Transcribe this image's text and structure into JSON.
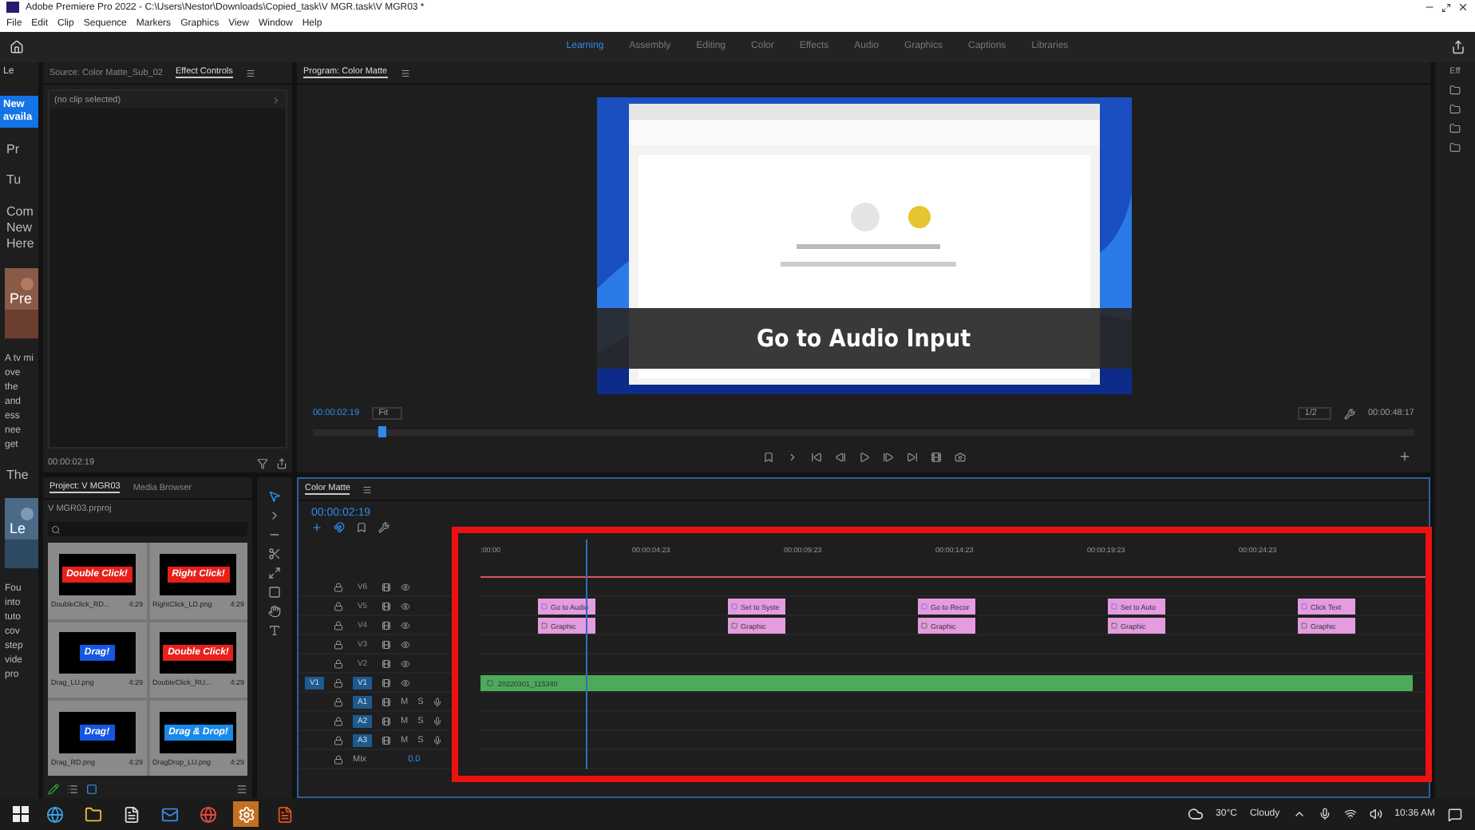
{
  "window": {
    "title": "Adobe Premiere Pro 2022 - C:\\Users\\Nestor\\Downloads\\Copied_task\\V MGR.task\\V MGR03 *"
  },
  "menu": [
    "File",
    "Edit",
    "Clip",
    "Sequence",
    "Markers",
    "Graphics",
    "View",
    "Window",
    "Help"
  ],
  "workspaces": [
    {
      "label": "Learning",
      "selected": true
    },
    {
      "label": "Assembly",
      "selected": false
    },
    {
      "label": "Editing",
      "selected": false
    },
    {
      "label": "Color",
      "selected": false
    },
    {
      "label": "Effects",
      "selected": false
    },
    {
      "label": "Audio",
      "selected": false
    },
    {
      "label": "Graphics",
      "selected": false
    },
    {
      "label": "Captions",
      "selected": false
    },
    {
      "label": "Libraries",
      "selected": false
    }
  ],
  "learn_panel": {
    "tab": "Le",
    "items": [
      {
        "kind": "banner",
        "text": "New availa"
      },
      {
        "kind": "heading",
        "text": "Pr"
      },
      {
        "kind": "heading",
        "text": "Tu"
      },
      {
        "kind": "heading",
        "text": "Com New Here"
      },
      {
        "kind": "picture",
        "text": "Pre"
      },
      {
        "kind": "body",
        "text": "A tv mi ove the and ess nee get"
      },
      {
        "kind": "heading",
        "text": "The"
      },
      {
        "kind": "picture",
        "text": "Le"
      },
      {
        "kind": "body",
        "text": "Fou into tuto cov step vide pro"
      }
    ]
  },
  "effect_panel": {
    "tabs": [
      {
        "label": "Source: Color Matte_Sub_02",
        "selected": false
      },
      {
        "label": "Effect Controls",
        "selected": true
      }
    ],
    "message": "(no clip selected)",
    "timecode": "00:00:02:19"
  },
  "project_panel": {
    "tabs": [
      {
        "label": "Project: V MGR03",
        "selected": true
      },
      {
        "label": "Media Browser",
        "selected": false
      }
    ],
    "file": "V MGR03.prproj",
    "items": [
      {
        "caption": "Double Click!",
        "name": "DoubleClick_RD...",
        "duration": "4:29",
        "color": "#e8201a"
      },
      {
        "caption": "Right Click!",
        "name": "RightClick_LD.png",
        "duration": "4:29",
        "color": "#e8201a"
      },
      {
        "caption": "Drag!",
        "name": "Drag_LU.png",
        "duration": "4:29",
        "color": "#1557e0"
      },
      {
        "caption": "Double Click!",
        "name": "DoubleClick_RU...",
        "duration": "4:29",
        "color": "#e8201a"
      },
      {
        "caption": "Drag!",
        "name": "Drag_RD.png",
        "duration": "4:29",
        "color": "#1557e0"
      },
      {
        "caption": "Drag & Drop!",
        "name": "DragDrop_LU.png",
        "duration": "4:29",
        "color": "#1a8ae8"
      }
    ]
  },
  "program_monitor": {
    "tab": "Program: Color Matte",
    "caption": "Go to Audio Input",
    "timecode": "00:00:02:19",
    "zoom": "Fit",
    "resolution": "1/2",
    "duration": "00:00:48:17",
    "playhead": {
      "level": 0.06
    }
  },
  "timeline": {
    "tab": "Color Matte",
    "timecode": "00:00:02:19",
    "ruler": [
      ":00:00",
      "00:00:04:23",
      "00:00:09:23",
      "00:00:14:23",
      "00:00:19:23",
      "00:00:24:23"
    ],
    "tracks": [
      {
        "kind": "video",
        "name": "V6",
        "targeted": false
      },
      {
        "kind": "video",
        "name": "V5",
        "targeted": false
      },
      {
        "kind": "video",
        "name": "V4",
        "targeted": false
      },
      {
        "kind": "video",
        "name": "V3",
        "targeted": false
      },
      {
        "kind": "video",
        "name": "V2",
        "targeted": false
      },
      {
        "kind": "video",
        "name": "V1",
        "targeted": true,
        "source": "V1"
      },
      {
        "kind": "audio",
        "name": "A1",
        "targeted": true,
        "mute": "M",
        "solo": "S"
      },
      {
        "kind": "audio",
        "name": "A2",
        "targeted": true,
        "mute": "M",
        "solo": "S"
      },
      {
        "kind": "audio",
        "name": "A3",
        "targeted": true,
        "mute": "M",
        "solo": "S"
      },
      {
        "kind": "mix",
        "name": "Mix",
        "value": "0.0"
      }
    ],
    "graphics": [
      {
        "title": "Go to Audio",
        "label": "Graphic"
      },
      {
        "title": "Set to Syste",
        "label": "Graphic"
      },
      {
        "title": "Go to Recor",
        "label": "Graphic"
      },
      {
        "title": "Set to Auto",
        "label": "Graphic"
      },
      {
        "title": "Click Text",
        "label": "Graphic"
      }
    ],
    "video_clip": "20220301_115340"
  },
  "right_panel": {
    "tab": "Eff"
  },
  "taskbar": {
    "temperature": "30°C",
    "weather": "Cloudy",
    "time": "10:36 AM"
  }
}
